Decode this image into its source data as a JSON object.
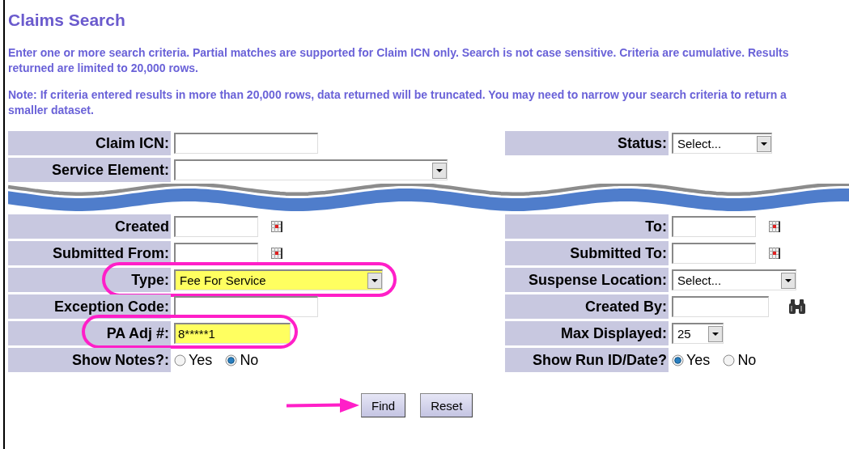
{
  "title": "Claims Search",
  "intro": "Enter one or more search criteria. Partial matches are supported for Claim ICN only. Search is not case sensitive. Criteria are cumulative. Results returned are limited to 20,000 rows.",
  "note": "Note: If criteria entered results in more than 20,000 rows, data returned will be truncated. You may need to narrow your search criteria to return a smaller dataset.",
  "upper_left": [
    {
      "kind": "text",
      "label": "Claim ICN:"
    },
    {
      "kind": "select",
      "label": "Service Element:"
    }
  ],
  "upper_right": [
    {
      "kind": "select",
      "label": "Status:",
      "value": "Select..."
    },
    {
      "kind": "blank"
    }
  ],
  "lower_left": [
    {
      "kind": "date",
      "label": "Created"
    },
    {
      "kind": "date",
      "label": "Submitted From:"
    },
    {
      "kind": "select",
      "label": "Type:",
      "value": "Fee For Service",
      "highlighted": true
    },
    {
      "kind": "text",
      "label": "Exception Code:"
    },
    {
      "kind": "text",
      "label": "PA Adj #:",
      "value": "8*****1",
      "highlighted": true
    },
    {
      "kind": "radio",
      "label": "Show Notes?:",
      "options": [
        {
          "label": "Yes",
          "selected": false
        },
        {
          "label": "No",
          "selected": true
        }
      ]
    }
  ],
  "lower_right": [
    {
      "kind": "date",
      "label": "To:"
    },
    {
      "kind": "date",
      "label": "Submitted To:"
    },
    {
      "kind": "select",
      "label": "Suspense Location:",
      "value": "Select..."
    },
    {
      "kind": "lookup",
      "label": "Created By:"
    },
    {
      "kind": "select",
      "label": "Max Displayed:",
      "value": "25"
    },
    {
      "kind": "radio",
      "label": "Show Run ID/Date?",
      "options": [
        {
          "label": "Yes",
          "selected": true
        },
        {
          "label": "No",
          "selected": false
        }
      ]
    }
  ],
  "buttons": [
    "Find",
    "Reset"
  ]
}
